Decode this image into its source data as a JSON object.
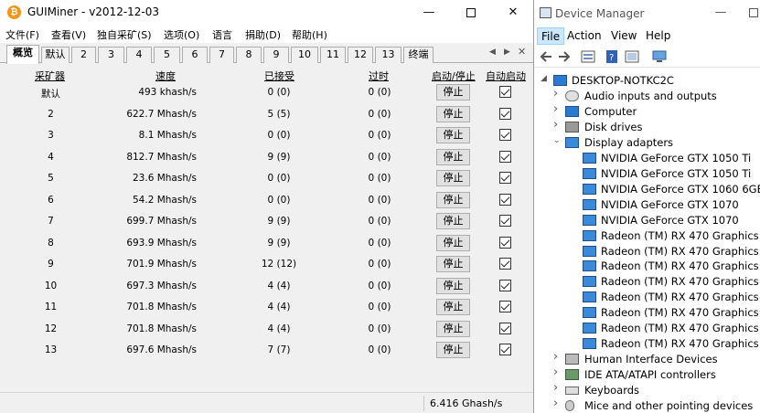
{
  "guiminer": {
    "title": "GUIMiner - v2012-12-03",
    "app_icon_glyph": "₿",
    "menu": [
      "文件(F)",
      "查看(V)",
      "独自采矿(S)",
      "选项(O)",
      "语言",
      "捐助(D)",
      "帮助(H)"
    ],
    "tabs": [
      "概览",
      "默认",
      "2",
      "3",
      "4",
      "5",
      "6",
      "7",
      "8",
      "9",
      "10",
      "11",
      "12",
      "13",
      "终端"
    ],
    "active_tab": "概览",
    "columns": {
      "miner": "采矿器",
      "speed": "速度",
      "accepted": "已接受",
      "stale": "过时",
      "start_stop": "启动/停止",
      "autostart": "自动启动"
    },
    "stop_label": "停止",
    "rows": [
      {
        "miner": "默认",
        "speed": "493 khash/s",
        "accepted": "0 (0)",
        "stale": "0 (0)",
        "autostart": true
      },
      {
        "miner": "2",
        "speed": "622.7 Mhash/s",
        "accepted": "5 (5)",
        "stale": "0 (0)",
        "autostart": true
      },
      {
        "miner": "3",
        "speed": "8.1 Mhash/s",
        "accepted": "0 (0)",
        "stale": "0 (0)",
        "autostart": true
      },
      {
        "miner": "4",
        "speed": "812.7 Mhash/s",
        "accepted": "9 (9)",
        "stale": "0 (0)",
        "autostart": true
      },
      {
        "miner": "5",
        "speed": "23.6 Mhash/s",
        "accepted": "0 (0)",
        "stale": "0 (0)",
        "autostart": true
      },
      {
        "miner": "6",
        "speed": "54.2 Mhash/s",
        "accepted": "0 (0)",
        "stale": "0 (0)",
        "autostart": true
      },
      {
        "miner": "7",
        "speed": "699.7 Mhash/s",
        "accepted": "9 (9)",
        "stale": "0 (0)",
        "autostart": true
      },
      {
        "miner": "8",
        "speed": "693.9 Mhash/s",
        "accepted": "9 (9)",
        "stale": "0 (0)",
        "autostart": true
      },
      {
        "miner": "9",
        "speed": "701.9 Mhash/s",
        "accepted": "12 (12)",
        "stale": "0 (0)",
        "autostart": true
      },
      {
        "miner": "10",
        "speed": "697.3 Mhash/s",
        "accepted": "4 (4)",
        "stale": "0 (0)",
        "autostart": true
      },
      {
        "miner": "11",
        "speed": "701.8 Mhash/s",
        "accepted": "4 (4)",
        "stale": "0 (0)",
        "autostart": true
      },
      {
        "miner": "12",
        "speed": "701.8 Mhash/s",
        "accepted": "4 (4)",
        "stale": "0 (0)",
        "autostart": true
      },
      {
        "miner": "13",
        "speed": "697.6 Mhash/s",
        "accepted": "7 (7)",
        "stale": "0 (0)",
        "autostart": true
      }
    ],
    "status_total": "6.416 Ghash/s"
  },
  "device_manager": {
    "title": "Device Manager",
    "menu": [
      "File",
      "Action",
      "View",
      "Help"
    ],
    "active_menu": "File",
    "root": "DESKTOP-NOTKC2C",
    "tree": [
      {
        "label": "Audio inputs and outputs",
        "icon": "speaker-icon",
        "level": 1,
        "expanded": false
      },
      {
        "label": "Computer",
        "icon": "computer-icon",
        "level": 1,
        "expanded": false
      },
      {
        "label": "Disk drives",
        "icon": "disk-icon",
        "level": 1,
        "expanded": false
      },
      {
        "label": "Display adapters",
        "icon": "display-adapter-icon",
        "level": 1,
        "expanded": true
      },
      {
        "label": "NVIDIA GeForce GTX 1050 Ti",
        "icon": "display-adapter-icon",
        "level": 2
      },
      {
        "label": "NVIDIA GeForce GTX 1050 Ti",
        "icon": "display-adapter-icon",
        "level": 2
      },
      {
        "label": "NVIDIA GeForce GTX 1060 6GB",
        "icon": "display-adapter-icon",
        "level": 2
      },
      {
        "label": "NVIDIA GeForce GTX 1070",
        "icon": "display-adapter-icon",
        "level": 2
      },
      {
        "label": "NVIDIA GeForce GTX 1070",
        "icon": "display-adapter-icon",
        "level": 2
      },
      {
        "label": "Radeon (TM) RX 470 Graphics",
        "icon": "display-adapter-icon",
        "level": 2
      },
      {
        "label": "Radeon (TM) RX 470 Graphics",
        "icon": "display-adapter-icon",
        "level": 2
      },
      {
        "label": "Radeon (TM) RX 470 Graphics",
        "icon": "display-adapter-icon",
        "level": 2
      },
      {
        "label": "Radeon (TM) RX 470 Graphics",
        "icon": "display-adapter-icon",
        "level": 2
      },
      {
        "label": "Radeon (TM) RX 470 Graphics",
        "icon": "display-adapter-icon",
        "level": 2
      },
      {
        "label": "Radeon (TM) RX 470 Graphics",
        "icon": "display-adapter-icon",
        "level": 2
      },
      {
        "label": "Radeon (TM) RX 470 Graphics",
        "icon": "display-adapter-icon",
        "level": 2
      },
      {
        "label": "Radeon (TM) RX 470 Graphics",
        "icon": "display-adapter-icon",
        "level": 2
      },
      {
        "label": "Human Interface Devices",
        "icon": "hid-icon",
        "level": 1,
        "expanded": false
      },
      {
        "label": "IDE ATA/ATAPI controllers",
        "icon": "ide-icon",
        "level": 1,
        "expanded": false
      },
      {
        "label": "Keyboards",
        "icon": "keyboard-icon",
        "level": 1,
        "expanded": false
      },
      {
        "label": "Mice and other pointing devices",
        "icon": "mouse-icon",
        "level": 1,
        "expanded": false
      }
    ]
  }
}
